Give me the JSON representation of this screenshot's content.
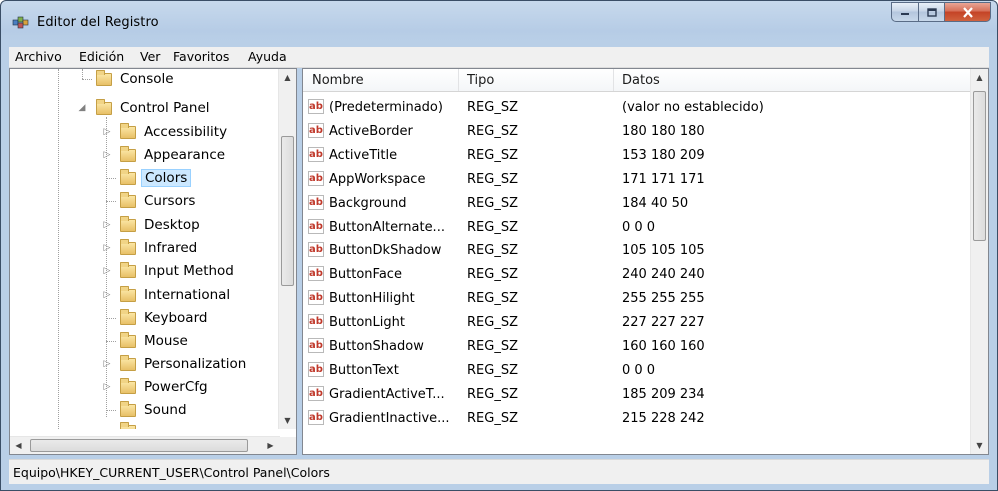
{
  "window": {
    "title": "Editor del Registro"
  },
  "menu": [
    "Archivo",
    "Edición",
    "Ver",
    "Favoritos",
    "Ayuda"
  ],
  "tree": {
    "nodes": [
      {
        "label": "Console",
        "expander": ""
      },
      {
        "label": "Control Panel",
        "expander": "◢"
      },
      {
        "label": "Accessibility",
        "expander": "▷"
      },
      {
        "label": "Appearance",
        "expander": "▷"
      },
      {
        "label": "Colors",
        "expander": "",
        "selected": true
      },
      {
        "label": "Cursors",
        "expander": ""
      },
      {
        "label": "Desktop",
        "expander": "▷"
      },
      {
        "label": "Infrared",
        "expander": "▷"
      },
      {
        "label": "Input Method",
        "expander": "▷"
      },
      {
        "label": "International",
        "expander": "▷"
      },
      {
        "label": "Keyboard",
        "expander": ""
      },
      {
        "label": "Mouse",
        "expander": ""
      },
      {
        "label": "Personalization",
        "expander": "▷"
      },
      {
        "label": "PowerCfg",
        "expander": "▷"
      },
      {
        "label": "Sound",
        "expander": ""
      }
    ]
  },
  "list": {
    "columns": [
      "Nombre",
      "Tipo",
      "Datos"
    ],
    "rows": [
      {
        "name": "(Predeterminado)",
        "type": "REG_SZ",
        "data": "(valor no establecido)"
      },
      {
        "name": "ActiveBorder",
        "type": "REG_SZ",
        "data": "180 180 180"
      },
      {
        "name": "ActiveTitle",
        "type": "REG_SZ",
        "data": "153 180 209"
      },
      {
        "name": "AppWorkspace",
        "type": "REG_SZ",
        "data": "171 171 171"
      },
      {
        "name": "Background",
        "type": "REG_SZ",
        "data": "184 40 50"
      },
      {
        "name": "ButtonAlternate...",
        "type": "REG_SZ",
        "data": "0 0 0"
      },
      {
        "name": "ButtonDkShadow",
        "type": "REG_SZ",
        "data": "105 105 105"
      },
      {
        "name": "ButtonFace",
        "type": "REG_SZ",
        "data": "240 240 240"
      },
      {
        "name": "ButtonHilight",
        "type": "REG_SZ",
        "data": "255 255 255"
      },
      {
        "name": "ButtonLight",
        "type": "REG_SZ",
        "data": "227 227 227"
      },
      {
        "name": "ButtonShadow",
        "type": "REG_SZ",
        "data": "160 160 160"
      },
      {
        "name": "ButtonText",
        "type": "REG_SZ",
        "data": "0 0 0"
      },
      {
        "name": "GradientActiveT...",
        "type": "REG_SZ",
        "data": "185 209 234"
      },
      {
        "name": "GradientInactive...",
        "type": "REG_SZ",
        "data": "215 228 242"
      }
    ],
    "value_icon": "ab"
  },
  "status": {
    "path": "Equipo\\HKEY_CURRENT_USER\\Control Panel\\Colors"
  },
  "colors": {
    "selection": "#cce8ff",
    "close_button": "#c44326",
    "frame": "#b9cfe7"
  },
  "icons": {
    "app": "registry-editor-icon",
    "minimize": "minimize-icon",
    "maximize": "maximize-icon",
    "close": "close-icon",
    "folder": "folder-icon",
    "string_value": "string-value-icon"
  }
}
